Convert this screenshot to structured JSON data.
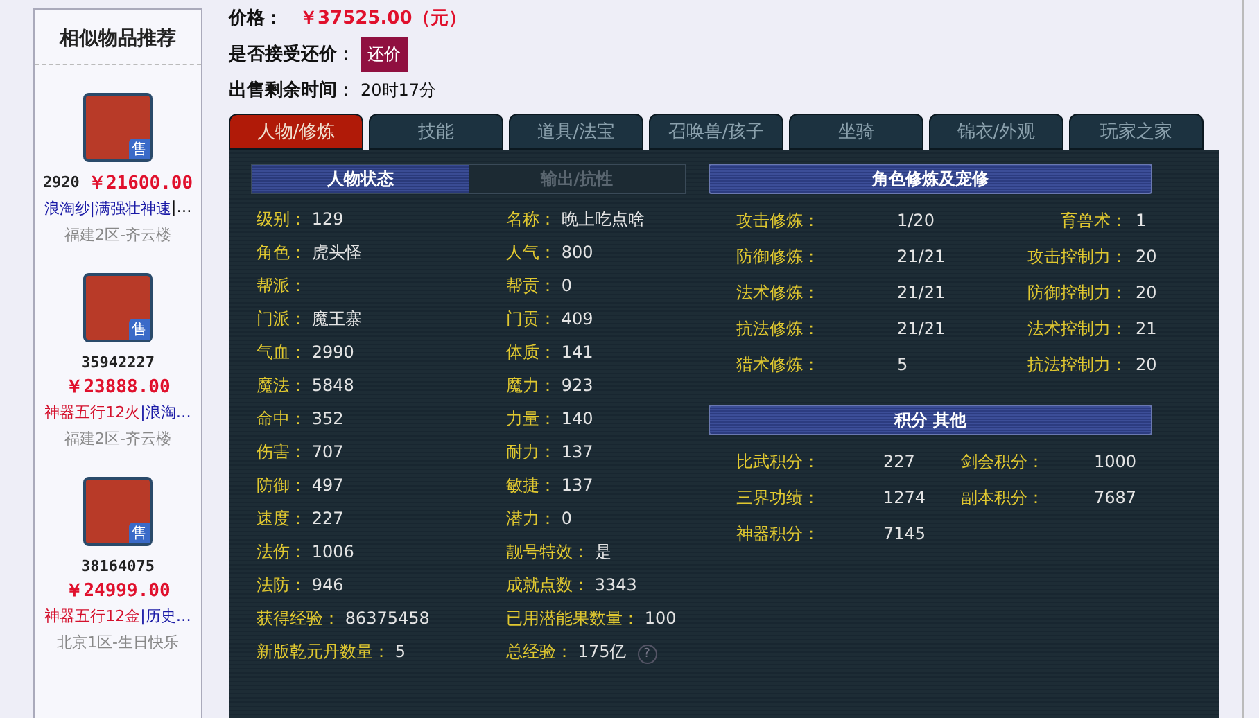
{
  "sidebar": {
    "title": "相似物品推荐",
    "items": [
      {
        "badge": "售",
        "id": "2920",
        "price": "￥21600.00",
        "tags": [
          {
            "text": "浪淘纱",
            "color": "#1a1aa6"
          },
          {
            "text": "|满强壮神速",
            "color": "#1a1aa6"
          },
          {
            "text": "|…",
            "color": "#111111"
          }
        ],
        "server": "福建2区-齐云楼"
      },
      {
        "badge": "售",
        "id": "35942227",
        "price": "￥23888.00",
        "tags": [
          {
            "text": "神器五行12火",
            "color": "#d4102c"
          },
          {
            "text": "|浪淘…",
            "color": "#1a1aa6"
          }
        ],
        "server": "福建2区-齐云楼"
      },
      {
        "badge": "售",
        "id": "38164075",
        "price": "￥24999.00",
        "tags": [
          {
            "text": "神器五行12金",
            "color": "#d4102c"
          },
          {
            "text": "|历史…",
            "color": "#1a1aa6"
          }
        ],
        "server": "北京1区-生日快乐"
      }
    ]
  },
  "info": {
    "price_label": "价格：",
    "price": "￥37525.00（元）",
    "bargain_label": "是否接受还价：",
    "bargain_button": "还价",
    "time_label": "出售剩余时间：",
    "time": "20时17分"
  },
  "tabs": [
    {
      "label": "人物/修炼",
      "selected": true
    },
    {
      "label": "技能",
      "selected": false
    },
    {
      "label": "道具/法宝",
      "selected": false
    },
    {
      "label": "召唤兽/孩子",
      "selected": false
    },
    {
      "label": "坐骑",
      "selected": false
    },
    {
      "label": "锦衣/外观",
      "selected": false
    },
    {
      "label": "玩家之家",
      "selected": false
    }
  ],
  "subtabs": [
    {
      "label": "人物状态",
      "selected": true
    },
    {
      "label": "输出/抗性",
      "selected": false
    }
  ],
  "stats": [
    {
      "label": "级别：",
      "value": "129"
    },
    {
      "label": "名称：",
      "value": "晚上吃点啥"
    },
    {
      "label": "角色：",
      "value": "虎头怪"
    },
    {
      "label": "人气：",
      "value": "800"
    },
    {
      "label": "帮派："
    },
    {
      "label": "帮贡：",
      "value": "0"
    },
    {
      "label": "门派：",
      "value": "魔王寨"
    },
    {
      "label": "门贡：",
      "value": "409"
    },
    {
      "label": "气血：",
      "value": "2990"
    },
    {
      "label": "体质：",
      "value": "141"
    },
    {
      "label": "魔法：",
      "value": "5848"
    },
    {
      "label": "魔力：",
      "value": "923"
    },
    {
      "label": "命中：",
      "value": "352"
    },
    {
      "label": "力量：",
      "value": "140"
    },
    {
      "label": "伤害：",
      "value": "707"
    },
    {
      "label": "耐力：",
      "value": "137"
    },
    {
      "label": "防御：",
      "value": "497"
    },
    {
      "label": "敏捷：",
      "value": "137"
    },
    {
      "label": "速度：",
      "value": "227"
    },
    {
      "label": "潜力：",
      "value": "0"
    },
    {
      "label": "法伤：",
      "value": "1006"
    },
    {
      "label": "靓号特效：",
      "value": "是"
    },
    {
      "label": "法防：",
      "value": "946"
    },
    {
      "label": "成就点数：",
      "value": "3343"
    },
    {
      "label": "获得经验：",
      "value": "86375458"
    },
    {
      "label": "已用潜能果数量：",
      "value": "100"
    },
    {
      "label": "新版乾元丹数量：",
      "value": "5"
    },
    {
      "label": "总经验：",
      "value": "175亿",
      "help": "?"
    }
  ],
  "cultivation": {
    "title": "角色修炼及宠修",
    "rows": [
      {
        "label": "攻击修炼：",
        "value": "1/20"
      },
      {
        "label": "育兽术：",
        "value": "1"
      },
      {
        "label": "防御修炼：",
        "value": "21/21"
      },
      {
        "label": "攻击控制力：",
        "value": "20"
      },
      {
        "label": "法术修炼：",
        "value": "21/21"
      },
      {
        "label": "防御控制力：",
        "value": "20"
      },
      {
        "label": "抗法修炼：",
        "value": "21/21"
      },
      {
        "label": "法术控制力：",
        "value": "21"
      },
      {
        "label": "猎术修炼：",
        "value": "5"
      },
      {
        "label": "抗法控制力：",
        "value": "20"
      }
    ]
  },
  "points": {
    "title": "积分 其他",
    "rows": [
      {
        "label": "比武积分：",
        "value": "227"
      },
      {
        "label": "剑会积分：",
        "value": "1000"
      },
      {
        "label": "三界功绩：",
        "value": "1274"
      },
      {
        "label": "副本积分：",
        "value": "7687"
      },
      {
        "label": "神器积分：",
        "value": "7145"
      }
    ]
  }
}
